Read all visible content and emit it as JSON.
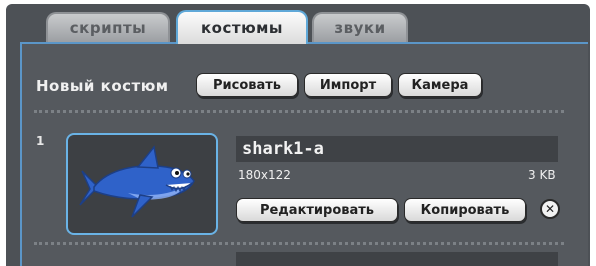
{
  "tabs": [
    {
      "label": "скрипты",
      "active": false
    },
    {
      "label": "костюмы",
      "active": true
    },
    {
      "label": "звуки",
      "active": false
    }
  ],
  "new_costume": {
    "label": "Новый костюм",
    "buttons": [
      "Рисовать",
      "Импорт",
      "Камера"
    ]
  },
  "costume": {
    "index": "1",
    "name": "shark1-a",
    "size": "180x122",
    "file_size": "3 KB",
    "edit_label": "Редактировать",
    "copy_label": "Копировать",
    "thumbnail_icon": "shark-icon",
    "delete_icon": "close-icon"
  },
  "colors": {
    "panel": "#55595e",
    "active_border": "#5b96c8",
    "shark": "#2f62c9"
  }
}
